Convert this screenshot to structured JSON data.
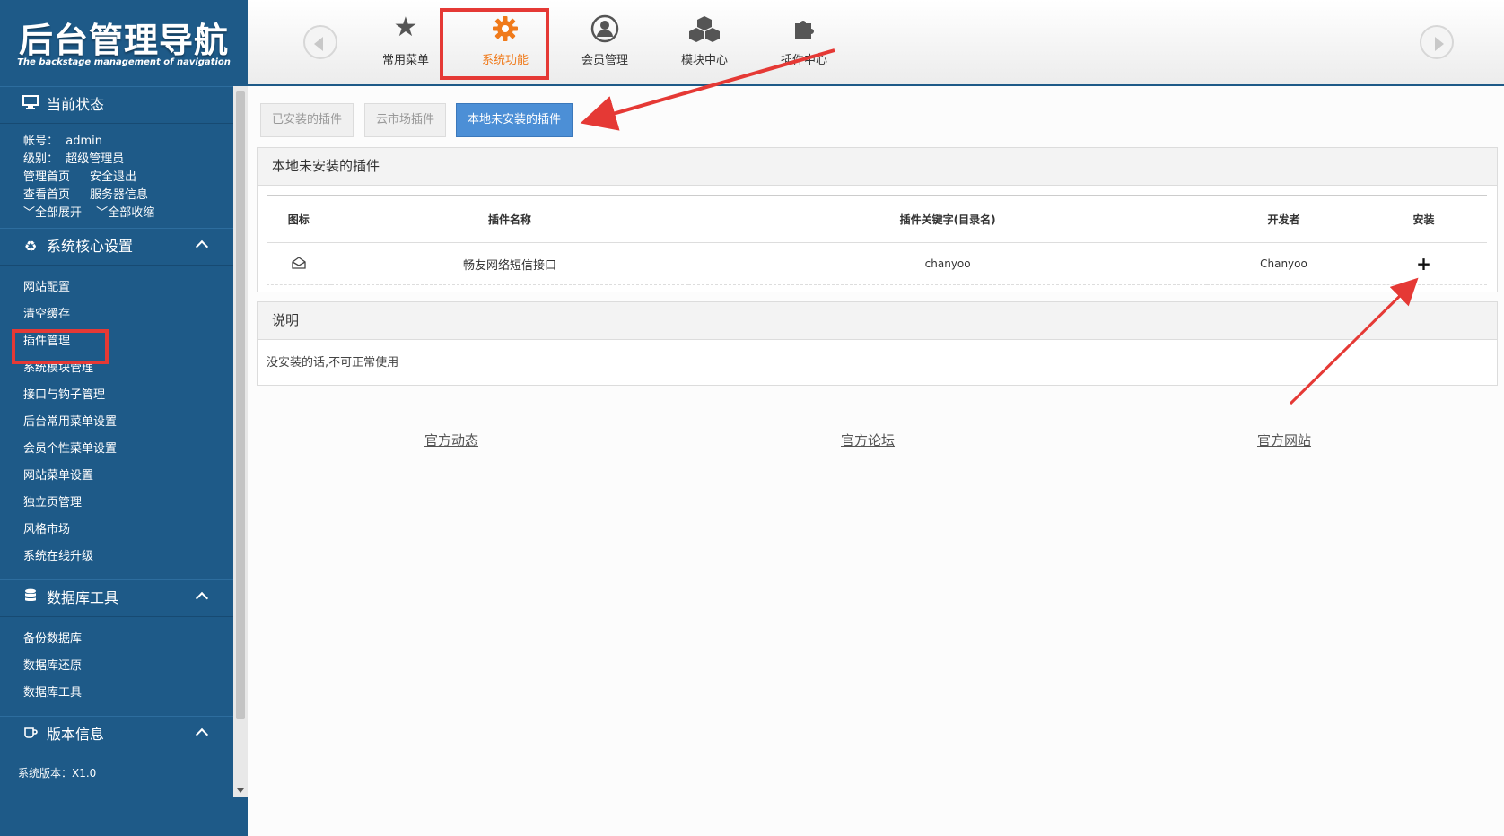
{
  "logo": {
    "title": "后台管理导航",
    "subtitle": "The backstage management of navigation"
  },
  "sidebar": {
    "status": {
      "heading": "当前状态",
      "account_label": "帐号：",
      "account_value": "admin",
      "level_label": "级别：",
      "level_value": "超级管理员",
      "links": [
        "管理首页",
        "安全退出",
        "查看首页",
        "服务器信息"
      ],
      "expand_all": "全部展开",
      "collapse_all": "全部收缩"
    },
    "core": {
      "heading": "系统核心设置",
      "items": [
        "网站配置",
        "清空缓存",
        "插件管理",
        "系统模块管理",
        "接口与钩子管理",
        "后台常用菜单设置",
        "会员个性菜单设置",
        "网站菜单设置",
        "独立页管理",
        "风格市场",
        "系统在线升级"
      ]
    },
    "db": {
      "heading": "数据库工具",
      "items": [
        "备份数据库",
        "数据库还原",
        "数据库工具"
      ]
    },
    "version": {
      "heading": "版本信息",
      "line1": "系统版本：X1.0"
    }
  },
  "topnav": {
    "items": [
      {
        "label": "常用菜单",
        "icon": "star-icon"
      },
      {
        "label": "系统功能",
        "icon": "gear-icon",
        "active": true
      },
      {
        "label": "会员管理",
        "icon": "user-icon"
      },
      {
        "label": "模块中心",
        "icon": "cubes-icon"
      },
      {
        "label": "插件中心",
        "icon": "puzzle-icon"
      }
    ]
  },
  "tabs": [
    "已安装的插件",
    "云市场插件",
    "本地未安装的插件"
  ],
  "plugins_panel": {
    "title": "本地未安装的插件",
    "headers": [
      "图标",
      "插件名称",
      "插件关键字(目录名)",
      "开发者",
      "安装"
    ],
    "rows": [
      {
        "name": "畅友网络短信接口",
        "keyword": "chanyoo",
        "developer": "Chanyoo",
        "install": "+"
      }
    ]
  },
  "note_panel": {
    "title": "说明",
    "text": "没安装的话,不可正常使用"
  },
  "footer": {
    "links": [
      "官方动态",
      "官方论坛",
      "官方网站"
    ]
  },
  "colors": {
    "sidebar": "#1e5a88",
    "accent_orange": "#f07a1a",
    "tab_active": "#4c8fd6",
    "annotation_red": "#e53935"
  }
}
